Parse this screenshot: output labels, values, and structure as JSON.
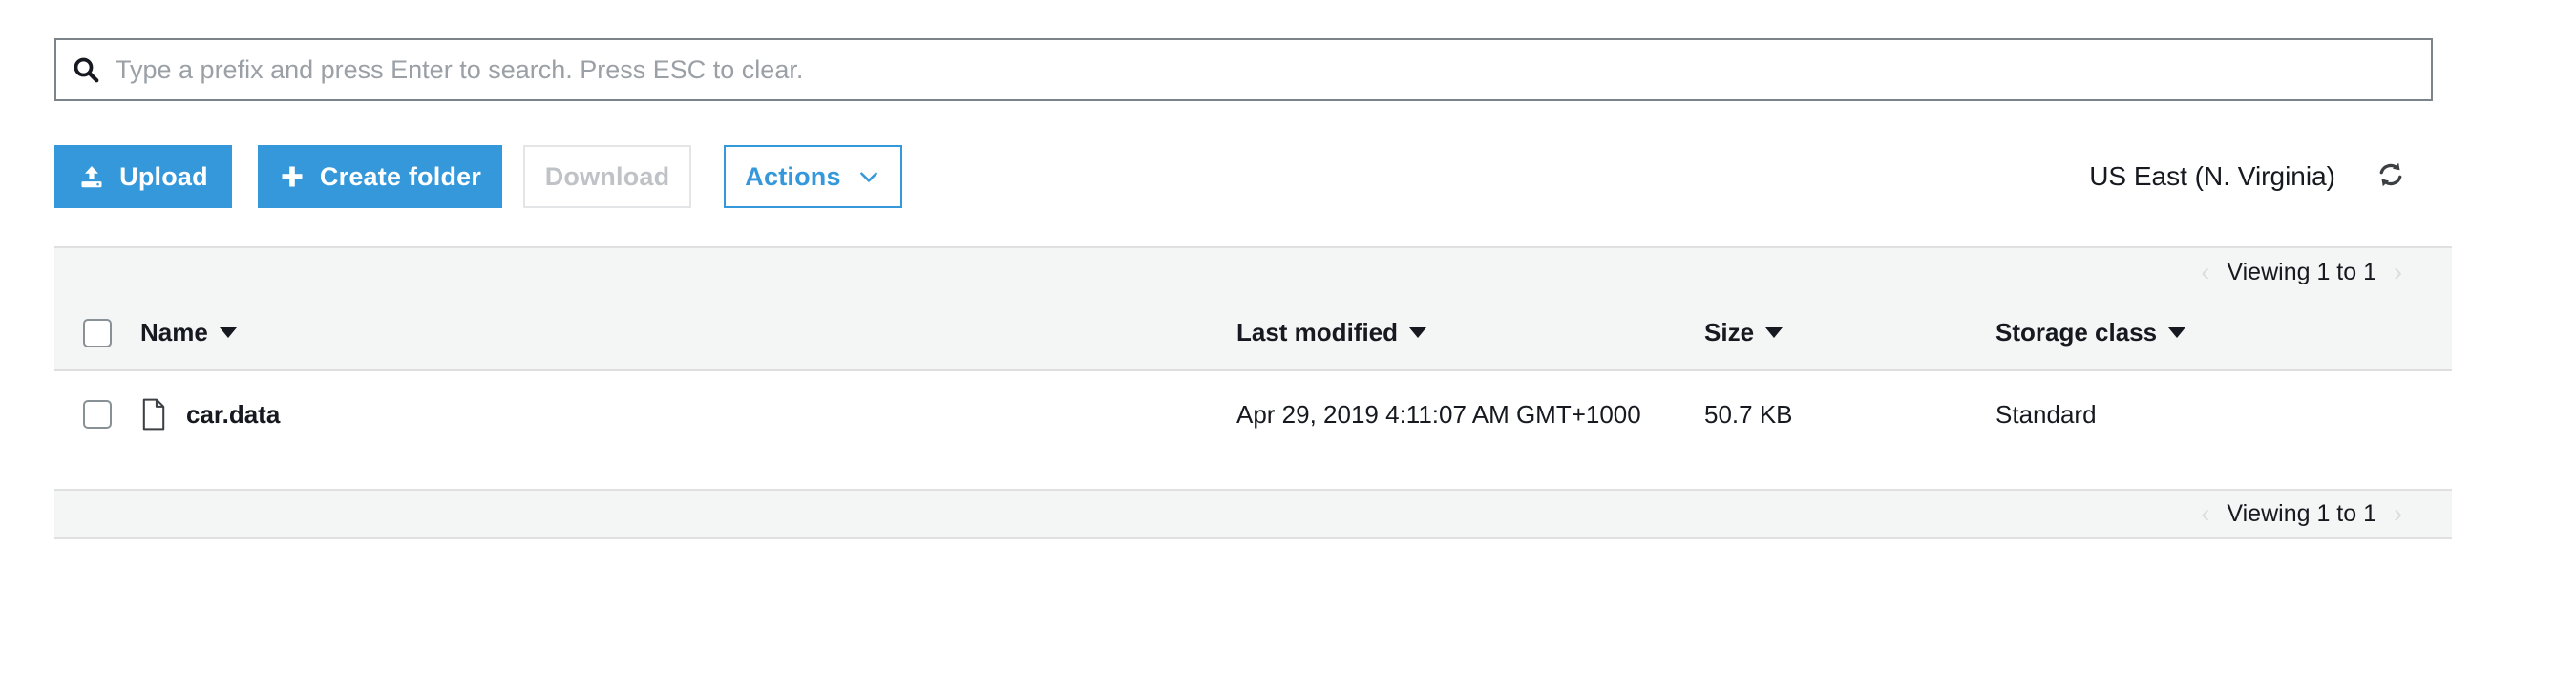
{
  "search": {
    "placeholder": "Type a prefix and press Enter to search. Press ESC to clear.",
    "value": "",
    "icon": "search-icon"
  },
  "toolbar": {
    "upload_label": "Upload",
    "upload_icon": "upload-icon",
    "create_folder_label": "Create folder",
    "create_folder_icon": "plus-icon",
    "download_label": "Download",
    "download_disabled": true,
    "actions_label": "Actions",
    "actions_icon": "chevron-down-icon",
    "region_label": "US East (N. Virginia)",
    "refresh_icon": "refresh-icon",
    "accent_color": "#3498db",
    "disabled_color": "#bfc3c7"
  },
  "pagination": {
    "top_label": "Viewing 1 to 1",
    "bottom_label": "Viewing 1 to 1",
    "prev_icon": "chevron-left-icon",
    "next_icon": "chevron-right-icon"
  },
  "table": {
    "columns": [
      {
        "label": "Name",
        "sort_icon": "caret-down-icon"
      },
      {
        "label": "Last modified",
        "sort_icon": "caret-down-icon"
      },
      {
        "label": "Size",
        "sort_icon": "caret-down-icon"
      },
      {
        "label": "Storage class",
        "sort_icon": "caret-down-icon"
      }
    ],
    "rows": [
      {
        "selected": false,
        "icon": "file-icon",
        "name": "car.data",
        "last_modified": "Apr 29, 2019 4:11:07 AM GMT+1000",
        "size": "50.7 KB",
        "storage_class": "Standard"
      }
    ]
  }
}
